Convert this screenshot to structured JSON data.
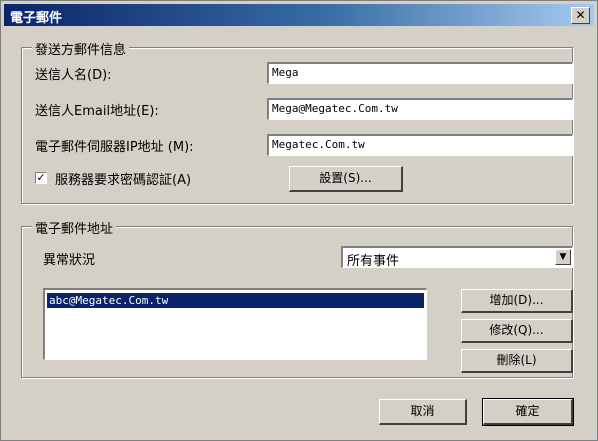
{
  "window": {
    "title": "電子郵件",
    "close_glyph": "✕"
  },
  "sender_group": {
    "legend": "發送方郵件信息",
    "sender_name_label": "送信人名(D):",
    "sender_name_value": "Mega",
    "sender_email_label": "送信人Email地址(E):",
    "sender_email_value": "Mega@Megatec.Com.tw",
    "smtp_label": "電子郵件伺服器IP地址 (M):",
    "smtp_value": "Megatec.Com.tw",
    "auth_checkbox_label": "服務器要求密碼認証(A)",
    "auth_checked": true,
    "settings_button": "設置(S)..."
  },
  "address_group": {
    "legend": "電子郵件地址",
    "event_label": "異常狀況",
    "event_select_value": "所有事件",
    "addresses": [
      "abc@Megatec.Com.tw"
    ],
    "add_button": "增加(D)...",
    "edit_button": "修改(Q)...",
    "delete_button": "刪除(L)"
  },
  "footer": {
    "cancel_button": "取消",
    "ok_button": "確定"
  }
}
